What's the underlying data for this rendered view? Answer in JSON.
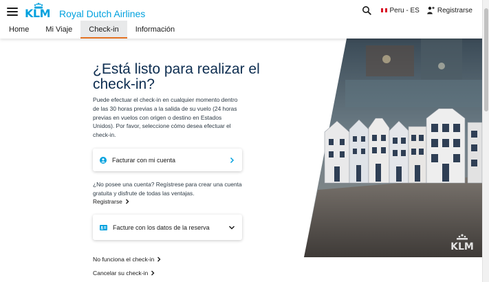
{
  "header": {
    "brand_name": "Royal Dutch Airlines",
    "logo_text": "KLM",
    "locale": "Peru - ES",
    "register": "Registrarse"
  },
  "nav": {
    "items": [
      {
        "label": "Home"
      },
      {
        "label": "Mi Viaje"
      },
      {
        "label": "Check-in"
      },
      {
        "label": "Información"
      }
    ],
    "active": "Check-in"
  },
  "main": {
    "title": "¿Está listo para realizar el check-in?",
    "description": "Puede efectuar el check-in en cualquier momento dentro de las 30 horas previas a la salida de su vuelo (24 horas previas en vuelos con origen o destino en Estados Unidos). Por favor, seleccione cómo desea efectuar el check-in.",
    "account_option": "Facturar con mi cuenta",
    "no_account_text": "¿No posee una cuenta? Regístrese para crear una cuenta gratuita y disfrute de todas las ventajas.",
    "register_link": "Registrarse",
    "booking_option": "Facture con los datos de la reserva",
    "link_not_working": "No funciona el check-in",
    "link_cancel": "Cancelar su check-in",
    "photo_watermark": "KLM"
  },
  "colors": {
    "brand_blue": "#00a1de",
    "title_navy": "#0d2d50",
    "active_tab_underline": "#e37222",
    "active_tab_bg": "#e8e9ea"
  },
  "icons": [
    "menu-icon",
    "crown-icon",
    "search-icon",
    "peru-flag-icon",
    "user-icon",
    "user-circle-icon",
    "chevron-right-icon",
    "id-card-icon",
    "chevron-down-icon"
  ]
}
